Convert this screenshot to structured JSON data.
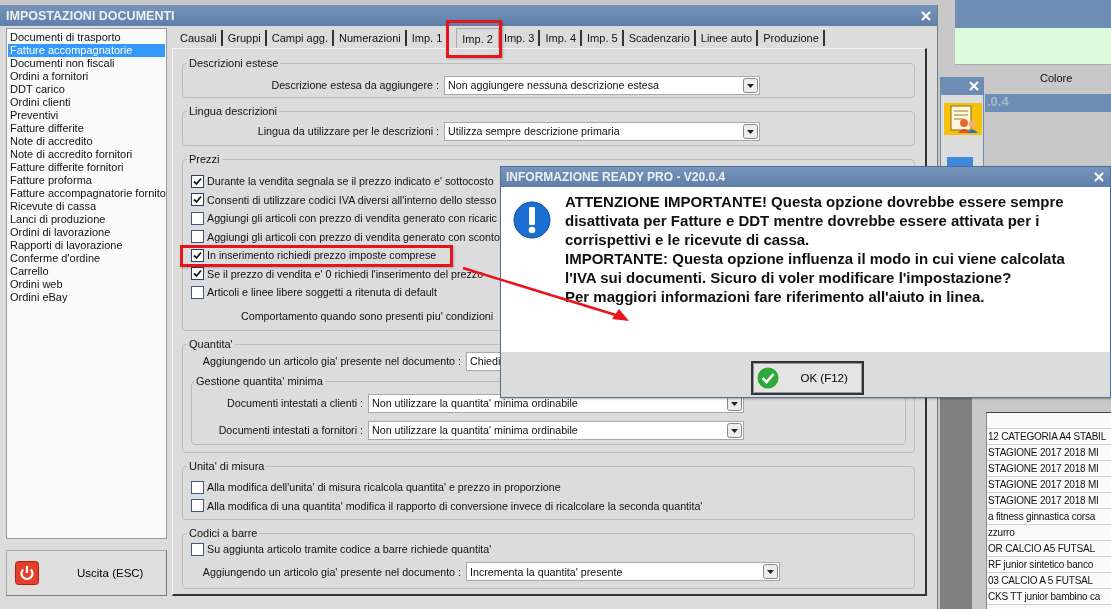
{
  "window": {
    "title": "IMPOSTAZIONI DOCUMENTI"
  },
  "sidebar": {
    "items": [
      {
        "label": "Documenti di trasporto",
        "selected": false
      },
      {
        "label": "Fatture accompagnatorie",
        "selected": true
      },
      {
        "label": "Documenti non fiscali",
        "selected": false
      },
      {
        "label": "Ordini a fornitori",
        "selected": false
      },
      {
        "label": "DDT carico",
        "selected": false
      },
      {
        "label": "Ordini clienti",
        "selected": false
      },
      {
        "label": "Preventivi",
        "selected": false
      },
      {
        "label": "Fatture differite",
        "selected": false
      },
      {
        "label": "Note di accredito",
        "selected": false
      },
      {
        "label": "Note di accredito fornitori",
        "selected": false
      },
      {
        "label": "Fatture differite fornitori",
        "selected": false
      },
      {
        "label": "Fatture proforma",
        "selected": false
      },
      {
        "label": "Fatture accompagnatorie fornito",
        "selected": false
      },
      {
        "label": "Ricevute di cassa",
        "selected": false
      },
      {
        "label": "Lanci di produzione",
        "selected": false
      },
      {
        "label": "Ordini di lavorazione",
        "selected": false
      },
      {
        "label": "Rapporti di lavorazione",
        "selected": false
      },
      {
        "label": "Conferme d'ordine",
        "selected": false
      },
      {
        "label": "Carrello",
        "selected": false
      },
      {
        "label": "Ordini web",
        "selected": false
      },
      {
        "label": "Ordini eBay",
        "selected": false
      }
    ]
  },
  "exit_button": {
    "label": "Uscita (ESC)"
  },
  "tabs": [
    {
      "label": "Causali",
      "selected": false
    },
    {
      "label": "Gruppi",
      "selected": false
    },
    {
      "label": "Campi agg.",
      "selected": false
    },
    {
      "label": "Numerazioni",
      "selected": false
    },
    {
      "label": "Imp. 1",
      "selected": false
    },
    {
      "label": "Imp. 2",
      "selected": true
    },
    {
      "label": "Imp. 3",
      "selected": false
    },
    {
      "label": "Imp. 4",
      "selected": false
    },
    {
      "label": "Imp. 5",
      "selected": false
    },
    {
      "label": "Scadenzario",
      "selected": false
    },
    {
      "label": "Linee auto",
      "selected": false
    },
    {
      "label": "Produzione",
      "selected": false
    }
  ],
  "groups": [
    {
      "title": "Descrizioni estese",
      "rows": [
        {
          "kind": "select",
          "label": "Descrizione estesa da aggiungere :",
          "value": "Non aggiungere nessuna descrizione estesa"
        }
      ]
    },
    {
      "title": "Lingua descrizioni",
      "rows": [
        {
          "kind": "select",
          "label": "Lingua da utilizzare per le descrizioni :",
          "value": "Utilizza sempre descrizione primaria"
        }
      ]
    },
    {
      "title": "Prezzi",
      "rows": [
        {
          "kind": "checkbox",
          "label": "Durante la vendita segnala se il prezzo indicato e' sottocosto",
          "checked": true
        },
        {
          "kind": "checkbox",
          "label": "Consenti di utilizzare codici IVA diversi all'interno dello stesso",
          "checked": true
        },
        {
          "kind": "checkbox",
          "label": "Aggiungi gli articoli con prezzo di vendita generato con ricaric",
          "checked": false
        },
        {
          "kind": "checkbox",
          "label": "Aggiungi gli articoli con prezzo di vendita generato con sconto",
          "checked": false
        },
        {
          "kind": "checkbox",
          "label": "In inserimento richiedi prezzo imposte comprese",
          "checked": true
        },
        {
          "kind": "checkbox",
          "label": "Se il prezzo di vendita e' 0 richiedi l'inserimento del prezzo",
          "checked": true
        },
        {
          "kind": "checkbox",
          "label": "Articoli e linee libere soggetti a ritenuta di default",
          "checked": false
        },
        {
          "kind": "text",
          "label": "Comportamento quando sono presenti piu' condizioni"
        }
      ]
    },
    {
      "title": "Quantita'",
      "rows": [
        {
          "kind": "select",
          "label": "Aggiungendo un articolo gia' presente nel documento :",
          "value": "Chiedi"
        },
        {
          "kind": "group",
          "title": "Gestione quantita' minima",
          "rows": [
            {
              "kind": "select",
              "label": "Documenti intestati a clienti :",
              "value": "Non utilizzare la quantita' minima ordinabile"
            },
            {
              "kind": "select",
              "label": "Documenti intestati a fornitori :",
              "value": "Non utilizzare la quantita' minima ordinabile"
            }
          ]
        }
      ]
    },
    {
      "title": "Unita' di misura",
      "rows": [
        {
          "kind": "checkbox",
          "label": "Alla modifica dell'unita' di misura ricalcola quantita' e prezzo in proporzione",
          "checked": false
        },
        {
          "kind": "checkbox",
          "label": "Alla modifica di una quantita' modifica il rapporto di conversione invece di ricalcolare la seconda quantita'",
          "checked": false
        }
      ]
    },
    {
      "title": "Codici a barre",
      "rows": [
        {
          "kind": "checkbox",
          "label": "Su aggiunta articolo tramite codice a barre richiede quantita'",
          "checked": false
        },
        {
          "kind": "select",
          "label": "Aggiungendo un articolo gia' presente nel documento :",
          "value": "Incrementa la quantita' presente"
        }
      ]
    }
  ],
  "background": {
    "group_label": "Colore",
    "window_title": ".0.4",
    "grid_rows": [
      "12 CATEGORIA A4 STABIL",
      "STAGIONE 2017 2018 MI",
      "STAGIONE 2017 2018 MI",
      "STAGIONE 2017 2018 MI",
      "STAGIONE 2017 2018 MI",
      "a fitness ginnastica corsa",
      "zzurro",
      "OR CALCIO A5 FUTSAL",
      "RF junior sintetico banco",
      "03 CALCIO A 5 FUTSAL",
      "CKS TT junior bambino ca"
    ]
  },
  "dialog": {
    "title": "INFORMAZIONE READY PRO - V20.0.4",
    "message": [
      "ATTENZIONE IMPORTANTE! Questa opzione dovrebbe essere sempre disattivata per Fatture e DDT mentre dovrebbe essere attivata per i corrispettivi e le ricevute di cassa.",
      "IMPORTANTE: Questa opzione influenza il modo in cui viene calcolata l'IVA sui documenti. Sicuro di voler modificare l'impostazione?",
      "Per maggiori informazioni fare riferimento all'aiuto in linea."
    ],
    "ok_button": "OK (F12)"
  }
}
